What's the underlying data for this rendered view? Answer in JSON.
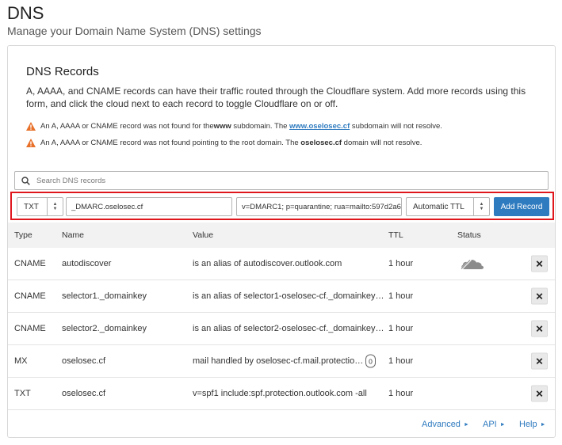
{
  "page": {
    "title": "DNS",
    "subtitle": "Manage your Domain Name System (DNS) settings"
  },
  "card": {
    "title": "DNS Records",
    "description": "A, AAAA, and CNAME records can have their traffic routed through the Cloudflare system. Add more records using this form, and click the cloud next to each record to toggle Cloudflare on or off.",
    "warnings": [
      {
        "text_before": "An A, AAAA or CNAME record was not found for the ",
        "bold": "www",
        "text_middle": " subdomain. The ",
        "link": "www.oselosec.cf",
        "text_after": " subdomain will not resolve."
      },
      {
        "text_before": "An A, AAAA or CNAME record was not found pointing to the root domain. The ",
        "bold": "oselosec.cf",
        "text_after": " domain will not resolve."
      }
    ]
  },
  "search": {
    "placeholder": "Search DNS records"
  },
  "add_form": {
    "type": "TXT",
    "name": "_DMARC.oselosec.cf",
    "value": "v=DMARC1; p=quarantine; rua=mailto:597d2a6",
    "ttl": "Automatic TTL",
    "add_label": "Add Record"
  },
  "table": {
    "headers": {
      "type": "Type",
      "name": "Name",
      "value": "Value",
      "ttl": "TTL",
      "status": "Status"
    },
    "rows": [
      {
        "type": "CNAME",
        "name": "autodiscover",
        "value": "is an alias of autodiscover.outlook.com",
        "ttl": "1 hour",
        "status": "cloud-grey-icon"
      },
      {
        "type": "CNAME",
        "name": "selector1._domainkey",
        "value": "is an alias of selector1-oselosec-cf._domainkey…",
        "ttl": "1 hour"
      },
      {
        "type": "CNAME",
        "name": "selector2._domainkey",
        "value": "is an alias of selector2-oselosec-cf._domainkey…",
        "ttl": "1 hour"
      },
      {
        "type": "MX",
        "name": "oselosec.cf",
        "value": "mail handled by oselosec-cf.mail.protectio…",
        "priority": "0",
        "ttl": "1 hour"
      },
      {
        "type": "TXT",
        "name": "oselosec.cf",
        "value": "v=spf1 include:spf.protection.outlook.com -all",
        "ttl": "1 hour"
      }
    ],
    "delete_symbol": "✕"
  },
  "footer": {
    "advanced": "Advanced",
    "api": "API",
    "help": "Help"
  },
  "colors": {
    "accent": "#2f7bbf",
    "highlight_border": "#e0161d",
    "warning": "#e8712a"
  }
}
